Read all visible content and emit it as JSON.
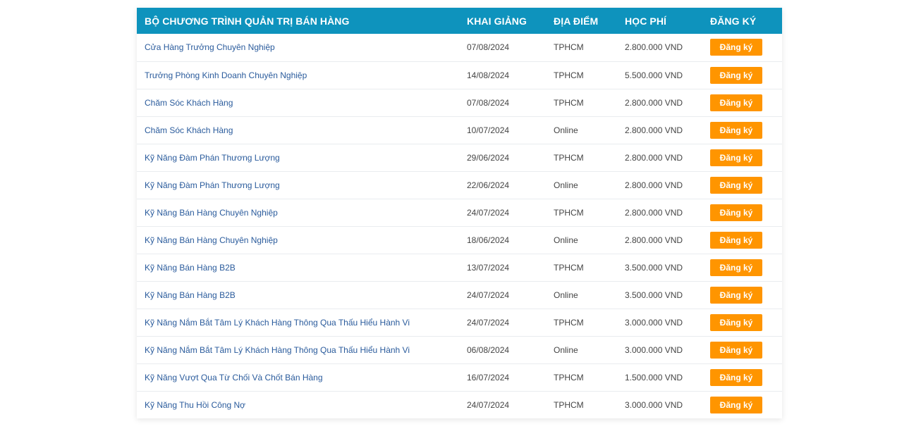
{
  "table": {
    "headers": {
      "program": "BỘ CHƯƠNG TRÌNH QUẢN TRỊ BÁN HÀNG",
      "start": "KHAI GIẢNG",
      "location": "ĐỊA ĐIỂM",
      "fee": "HỌC PHÍ",
      "register": "ĐĂNG KÝ"
    },
    "colors": {
      "header_bg": "#0e93bd",
      "link": "#2a5b9c",
      "button_bg": "#ff9500"
    },
    "rows": [
      {
        "course": "Cửa Hàng Trưởng Chuyên Nghiệp",
        "date": "07/08/2024",
        "location": "TPHCM",
        "fee": "2.800.000 VND",
        "button": "Đăng ký"
      },
      {
        "course": "Trưởng Phòng Kinh Doanh Chuyên Nghiệp",
        "date": "14/08/2024",
        "location": "TPHCM",
        "fee": "5.500.000 VND",
        "button": "Đăng ký"
      },
      {
        "course": "Chăm Sóc Khách Hàng",
        "date": "07/08/2024",
        "location": "TPHCM",
        "fee": "2.800.000 VND",
        "button": "Đăng ký"
      },
      {
        "course": "Chăm Sóc Khách Hàng",
        "date": "10/07/2024",
        "location": "Online",
        "fee": "2.800.000 VND",
        "button": "Đăng ký"
      },
      {
        "course": "Kỹ Năng Đàm Phán Thương Lượng",
        "date": "29/06/2024",
        "location": "TPHCM",
        "fee": "2.800.000 VND",
        "button": "Đăng ký"
      },
      {
        "course": "Kỹ Năng Đàm Phán Thương Lượng",
        "date": "22/06/2024",
        "location": "Online",
        "fee": "2.800.000 VND",
        "button": "Đăng ký"
      },
      {
        "course": "Kỹ Năng Bán Hàng Chuyên Nghiệp",
        "date": "24/07/2024",
        "location": "TPHCM",
        "fee": "2.800.000 VND",
        "button": "Đăng ký"
      },
      {
        "course": "Kỹ Năng Bán Hàng Chuyên Nghiệp",
        "date": "18/06/2024",
        "location": "Online",
        "fee": "2.800.000 VND",
        "button": "Đăng ký"
      },
      {
        "course": "Kỹ Năng Bán Hàng B2B",
        "date": "13/07/2024",
        "location": "TPHCM",
        "fee": "3.500.000 VND",
        "button": "Đăng ký"
      },
      {
        "course": "Kỹ Năng Bán Hàng B2B",
        "date": "24/07/2024",
        "location": "Online",
        "fee": "3.500.000 VND",
        "button": "Đăng ký"
      },
      {
        "course": "Kỹ Năng Nắm Bắt Tâm Lý Khách Hàng Thông Qua Thấu Hiểu Hành Vi",
        "date": "24/07/2024",
        "location": "TPHCM",
        "fee": "3.000.000 VND",
        "button": "Đăng ký"
      },
      {
        "course": "Kỹ Năng Nắm Bắt Tâm Lý Khách Hàng Thông Qua Thấu Hiểu Hành Vi",
        "date": "06/08/2024",
        "location": "Online",
        "fee": "3.000.000 VND",
        "button": "Đăng ký"
      },
      {
        "course": "Kỹ Năng Vượt Qua Từ Chối Và Chốt Bán Hàng",
        "date": "16/07/2024",
        "location": "TPHCM",
        "fee": "1.500.000 VND",
        "button": "Đăng ký"
      },
      {
        "course": "Kỹ Năng Thu Hồi Công Nợ",
        "date": "24/07/2024",
        "location": "TPHCM",
        "fee": "3.000.000 VND",
        "button": "Đăng ký"
      }
    ]
  }
}
